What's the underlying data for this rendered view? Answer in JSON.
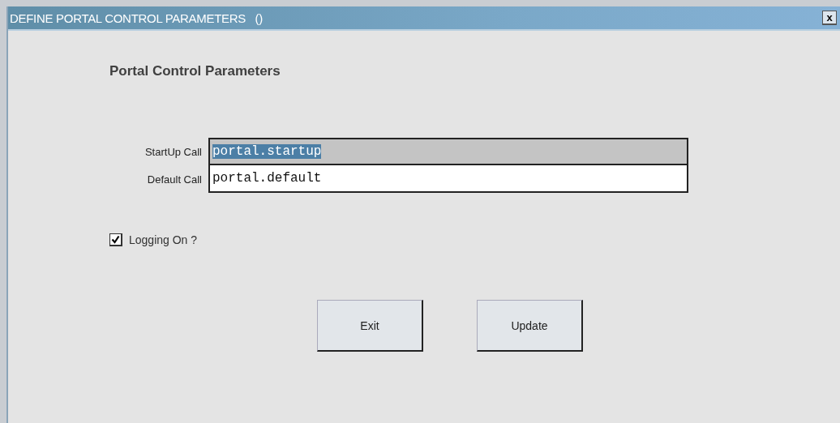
{
  "window": {
    "title": "DEFINE PORTAL CONTROL PARAMETERS   ()",
    "close_label": "x"
  },
  "heading": "Portal Control Parameters",
  "fields": [
    {
      "label": "StartUp Call",
      "value": "portal.startup",
      "selected": true
    },
    {
      "label": "Default Call",
      "value": "portal.default",
      "selected": false
    }
  ],
  "checkbox": {
    "label": "Logging On ?",
    "checked": true
  },
  "buttons": [
    "Exit",
    "Update"
  ]
}
